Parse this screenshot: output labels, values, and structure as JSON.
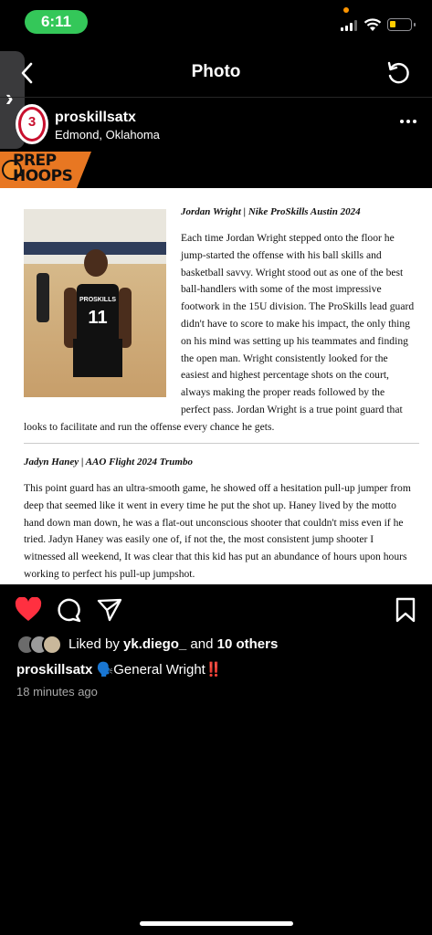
{
  "status_bar": {
    "time": "6:11",
    "battery_fraction": 0.2
  },
  "header": {
    "title": "Photo"
  },
  "post": {
    "username": "proskillsatx",
    "location": "Edmond, Oklahoma",
    "avatar_text": "3"
  },
  "photo": {
    "banner_line1": "PREP",
    "banner_line2": "HOOPS",
    "jersey_brand": "PROSKILLS",
    "jersey_number": "11",
    "article1": {
      "title": "Jordan Wright | Nike ProSkills Austin 2024",
      "lines": [
        "Each time Jordan Wright stepped onto the floor he",
        "jump-started the offense with his ball skills and",
        "basketball savvy. Wright stood out as one of the best",
        "ball-handlers with some of the most impressive",
        "footwork in the 15U division. The ProSkills lead guard",
        "didn't have to score to make his impact, the only thing",
        "on his mind was setting up his teammates and finding",
        "the open man. Wright consistently looked for the",
        "easiest and highest percentage shots on the court,",
        "always making the proper reads followed by the",
        "perfect pass. Jordan Wright is a true point guard that"
      ],
      "last_line": "looks to facilitate and run the offense every chance he gets."
    },
    "article2": {
      "title": "Jadyn Haney | AAO Flight 2024 Trumbo",
      "lines": [
        "This point guard has an ultra-smooth game, he showed off a hesitation pull-up jumper from",
        "deep that seemed like it went in every time he put the shot up. Haney lived by the motto",
        "hand down man down, he was a flat-out unconscious shooter that couldn't miss even if he",
        "tried. Jadyn Haney was easily one of, if not the, the most consistent jump shooter I",
        "witnessed all weekend, It was clear that this kid has put an abundance of hours upon hours",
        "working to perfect his pull-up jumpshot."
      ]
    }
  },
  "likes": {
    "prefix": "Liked by ",
    "user": "yk.diego_",
    "middle": " and ",
    "others": "10 others"
  },
  "caption": {
    "user": "proskillsatx",
    "emoji": "🗣️",
    "text": "General Wright",
    "emphasis": "‼️"
  },
  "timestamp": "18 minutes ago",
  "colors": {
    "like_red": "#ff3040",
    "status_green": "#34c759",
    "banner_orange": "#e87722"
  }
}
